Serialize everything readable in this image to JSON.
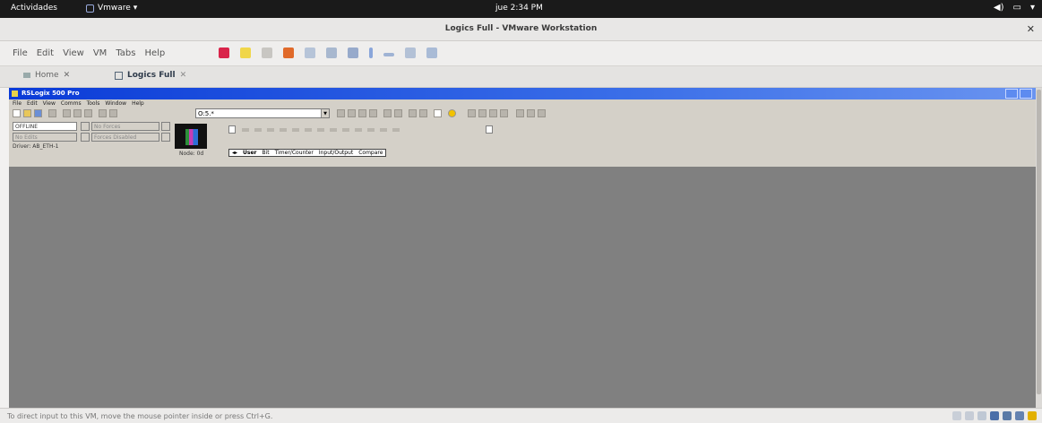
{
  "topbar": {
    "activities": "Actividades",
    "app_menu": "Vmware ▾",
    "clock": "jue 2:34 PM"
  },
  "window": {
    "title": "Logics Full - VMware Workstation",
    "close_glyph": "✕"
  },
  "menu": {
    "items": [
      "File",
      "Edit",
      "View",
      "VM",
      "Tabs",
      "Help"
    ]
  },
  "tabs": [
    {
      "label": "Home",
      "close": "✕"
    },
    {
      "label": "Logics Full",
      "close": "✕"
    }
  ],
  "app": {
    "title": "RSLogix 500 Pro",
    "menu": [
      "File",
      "Edit",
      "View",
      "Comms",
      "Tools",
      "Window",
      "Help"
    ],
    "address_combo": "O:5.*",
    "status": {
      "mode": "OFFLINE",
      "edits": "No Edits",
      "forced": "No Forces",
      "forces_disabled": "Forces Disabled",
      "driver": "Driver: AB_ETH-1",
      "node": "Node: 0d"
    },
    "instruction_tabs": [
      "User",
      "Bit",
      "Timer/Counter",
      "Input/Output",
      "Compare"
    ]
  },
  "statusbar": {
    "hint": "To direct input to this VM, move the mouse pointer inside or press Ctrl+G."
  },
  "colors": {
    "vm_background": "#808080",
    "app_titlebar": "#0a3bd7"
  }
}
